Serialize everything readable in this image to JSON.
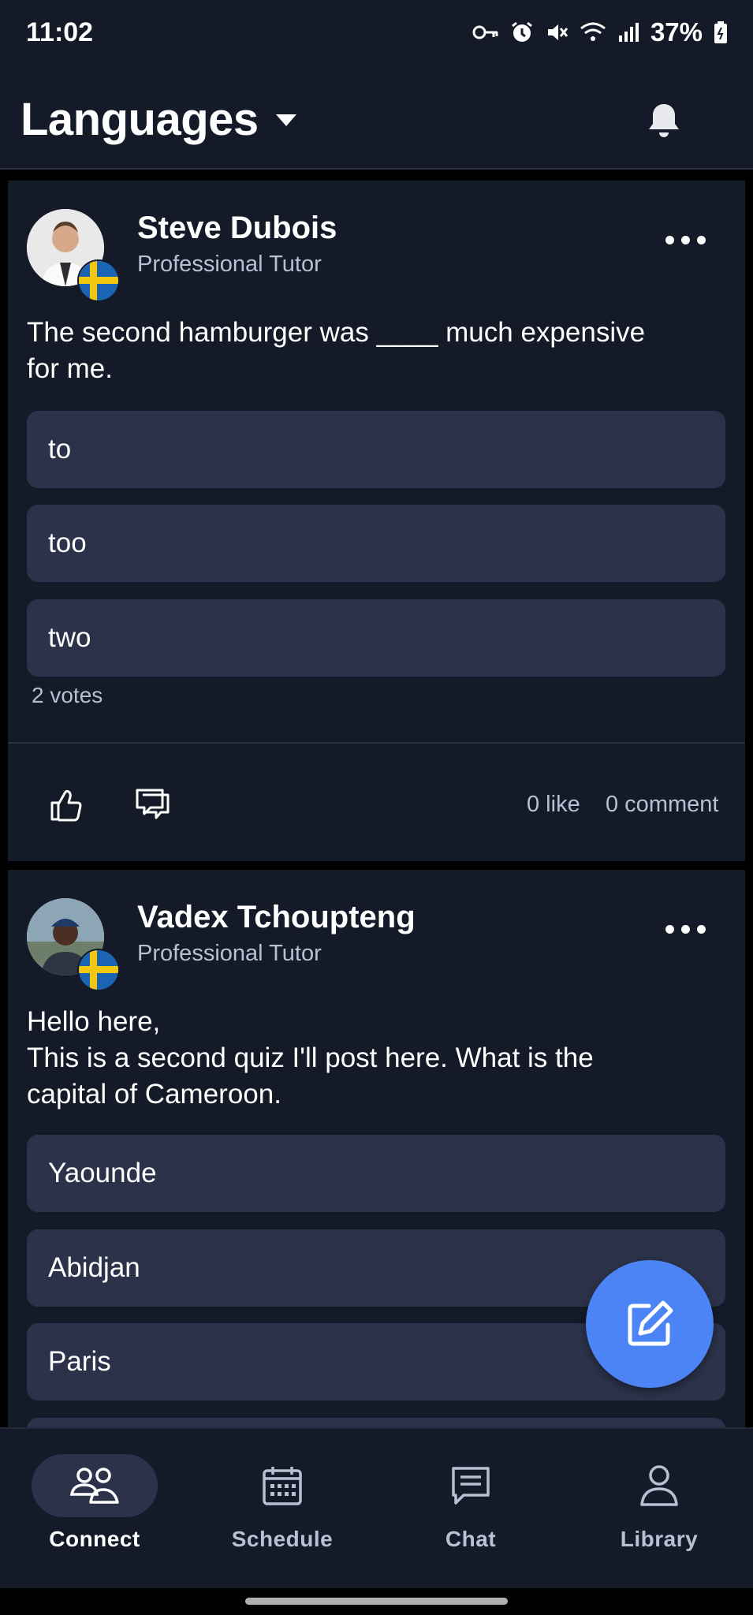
{
  "status_bar": {
    "time": "11:02",
    "battery": "37%"
  },
  "header": {
    "title": "Languages",
    "dropdown_icon": "caret-down-icon",
    "notification_icon": "bell-icon"
  },
  "posts": [
    {
      "author": "Steve Dubois",
      "role": "Professional Tutor",
      "flag": "sweden-flag",
      "question_lines": [
        "The second hamburger was ____ much expensive",
        "for me."
      ],
      "options": [
        "to",
        "too",
        "two"
      ],
      "votes": "2 votes",
      "likes": "0 like",
      "comments": "0 comment"
    },
    {
      "author": "Vadex Tchoupteng",
      "role": "Professional Tutor",
      "flag": "sweden-flag",
      "question_lines": [
        "Hello here,",
        "This is a second quiz I'll post here. What is the",
        "capital of Cameroon."
      ],
      "options": [
        "Yaounde",
        "Abidjan",
        "Paris",
        ""
      ]
    }
  ],
  "fab": {
    "icon": "edit-icon"
  },
  "nav": [
    {
      "label": "Connect",
      "icon": "people-icon",
      "active": true
    },
    {
      "label": "Schedule",
      "icon": "calendar-icon",
      "active": false
    },
    {
      "label": "Chat",
      "icon": "chat-icon",
      "active": false
    },
    {
      "label": "Library",
      "icon": "person-icon",
      "active": false
    }
  ],
  "colors": {
    "background": "#141a28",
    "option_bg": "#2b3249",
    "accent": "#4d84f5",
    "muted_text": "#b8c0d4"
  }
}
